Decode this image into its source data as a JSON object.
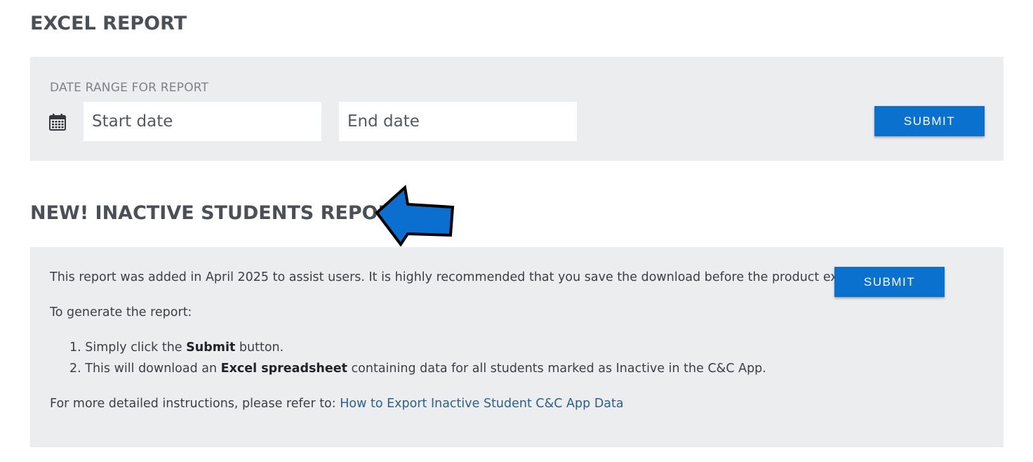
{
  "excel_section": {
    "title": "EXCEL REPORT",
    "range_label": "DATE RANGE FOR REPORT",
    "start_placeholder": "Start date",
    "end_placeholder": "End date",
    "start_value": "",
    "end_value": "",
    "submit_label": "SUBMIT"
  },
  "inactive_section": {
    "title": "NEW! INACTIVE STUDENTS REPORT",
    "intro": "This report was added in April 2025 to assist users. It is highly recommended that you save the download before the product expires.",
    "submit_label": "SUBMIT",
    "generate_label": "To generate the report:",
    "steps": [
      {
        "number": "1.",
        "prefix": "Simply click the ",
        "bold": "Submit",
        "suffix": " button."
      },
      {
        "number": "2.",
        "prefix": "This will download an ",
        "bold": "Excel spreadsheet",
        "suffix": " containing data for all students marked as Inactive in the C&C App."
      }
    ],
    "more_prefix": "For more detailed instructions, please refer to: ",
    "link_text": "How to Export Inactive Student C&C App Data"
  },
  "icons": {
    "calendar": "calendar-icon",
    "arrow": "arrow-left-icon"
  },
  "colors": {
    "button": "#0a71cf",
    "panel": "#ecedef",
    "heading": "#4b5057",
    "link": "#2c5f8a",
    "arrow": "#0a6fcf"
  }
}
